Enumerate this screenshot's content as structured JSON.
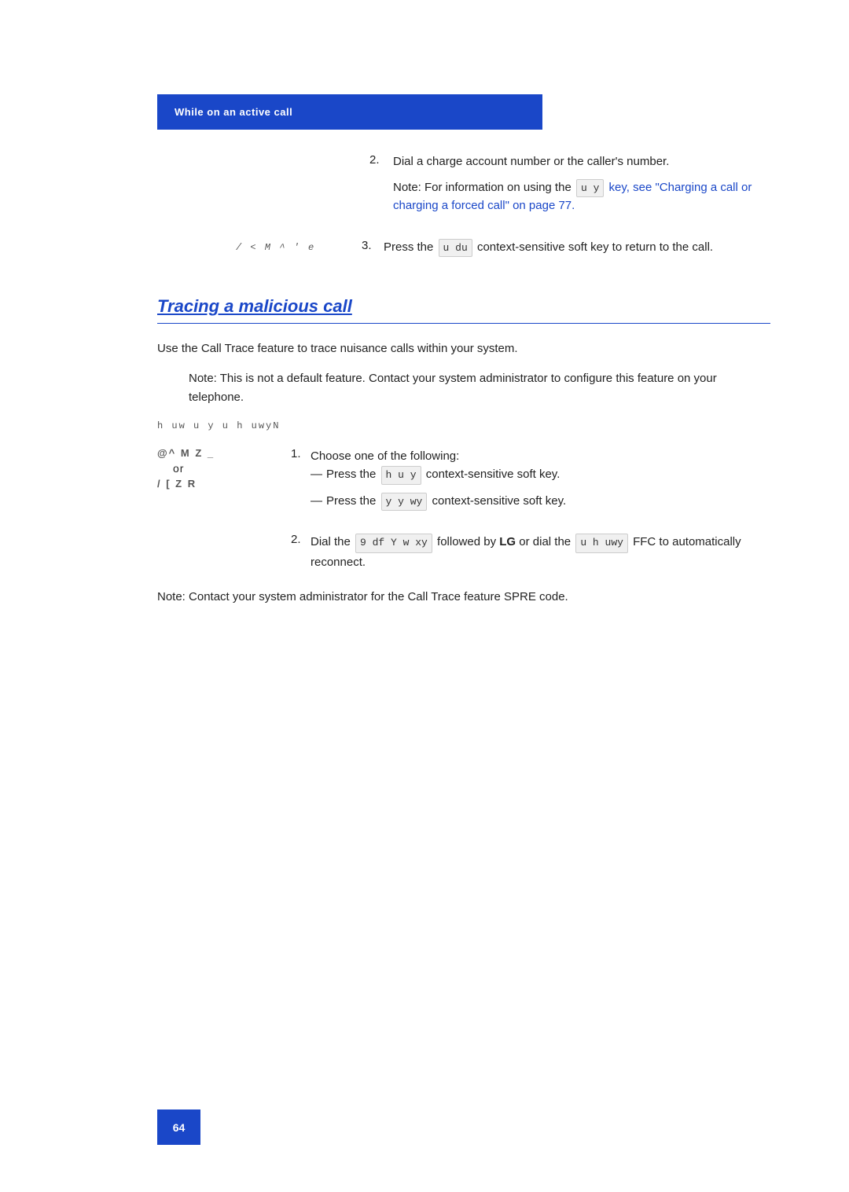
{
  "header": {
    "banner_text": "While on an active call"
  },
  "step2": {
    "text": "Dial a charge account number or the caller's number.",
    "note_prefix": "Note:  For information on using the",
    "note_key": "u   y",
    "note_link": "key, see \"Charging a call or charging a forced call\" on page 77."
  },
  "step3": {
    "image_label": "/ < M ^ ' e",
    "number": "3.",
    "text_prefix": "Press the",
    "key_label": "u  du",
    "text_suffix": "context-sensitive soft key to return to the call."
  },
  "section": {
    "title": "Tracing a malicious call",
    "intro": "Use the Call Trace feature to trace nuisance calls within your system.",
    "note": "Note:  This is not a default feature. Contact your system administrator to configure this feature on your telephone.",
    "procedure_header": "h  uw   u y  u  h uwyN"
  },
  "proc_step1": {
    "image1": "@^ M Z _",
    "image2": "/ [ Z R",
    "or_label": "or",
    "number": "1.",
    "intro": "Choose one of the following:",
    "bullet1_prefix": "Press the",
    "bullet1_key": "h u   y",
    "bullet1_suffix": "context-sensitive soft key.",
    "bullet2_prefix": "Press the",
    "bullet2_key": "y y  wy",
    "bullet2_suffix": "context-sensitive soft key."
  },
  "proc_step2": {
    "number": "2.",
    "text1_prefix": "Dial the",
    "text1_key": "9 df Y w  xy",
    "text1_middle": "followed by",
    "text1_bold": "LG",
    "text1_or": "or dial the",
    "text1_key2": "u   h uwy",
    "text1_end": "FFC to automatically reconnect."
  },
  "note_bottom": "Note:  Contact your system administrator for the Call Trace feature SPRE code.",
  "page_number": "64"
}
